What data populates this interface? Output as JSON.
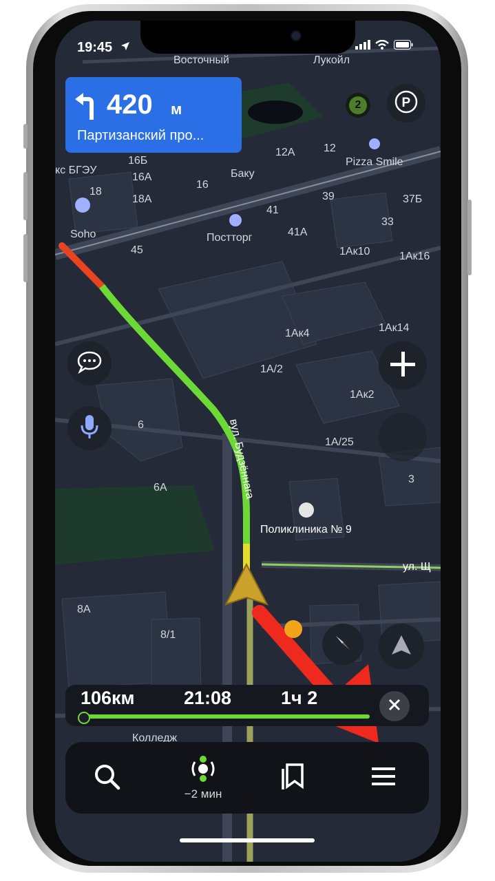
{
  "status_bar": {
    "time": "19:45"
  },
  "maneuver": {
    "distance": "420",
    "unit": "м",
    "street": "Партизанский про..."
  },
  "map_badge": {
    "count": "2"
  },
  "map_labels": {
    "b16b": "16Б",
    "b16a": "16А",
    "b16": "16",
    "b18": "18",
    "b18a": "18А",
    "b12a": "12А",
    "b12": "12",
    "b41": "41",
    "b41a": "41А",
    "b39": "39",
    "b37b": "37Б",
    "b33": "33",
    "b45": "45",
    "b1ak10": "1Ак10",
    "b1ak16": "1Ак16",
    "b1ak4": "1Ак4",
    "b1ak14": "1Ак14",
    "b1a2": "1А/2",
    "b1ak2": "1Ак2",
    "b1a25": "1А/25",
    "b6": "6",
    "b6a": "6А",
    "b3": "3",
    "b8a": "8А",
    "b81": "8/1",
    "baku": "Баку",
    "posttorg": "Постторг",
    "soho": "Soho",
    "pizza": "Pizza Smile",
    "kbgeu": "кс БГЭУ",
    "lukoil": "Лукойл",
    "vostochny": "Восточный",
    "poliklinika": "Поликлиника № 9",
    "kolledzh": "Колледж",
    "street_budennogo": "вул. Будзённага",
    "street_sch": "ул. Щ"
  },
  "trip": {
    "distance": "106км",
    "arrival": "21:08",
    "duration": "1ч 2"
  },
  "toolbar": {
    "route_hint": "−2 мин"
  },
  "colors": {
    "route_green": "#6cd936",
    "route_red": "#e8441f",
    "maneuver_blue": "#2b6fe6",
    "arrow_red": "#ee2a1e"
  },
  "icons": {
    "status": [
      "location-arrow-icon",
      "signal-icon",
      "wifi-icon",
      "battery-icon"
    ],
    "map": [
      "chat-icon",
      "microphone-icon",
      "zoom-in-icon",
      "parking-icon",
      "compass-icon",
      "navigation-arrow-icon",
      "close-icon"
    ],
    "toolbar": [
      "search-icon",
      "route-overview-icon",
      "bookmarks-icon",
      "menu-icon"
    ]
  }
}
